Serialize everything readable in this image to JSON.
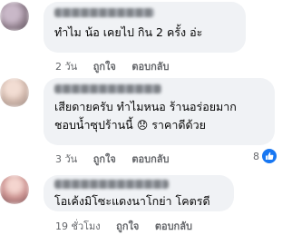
{
  "comments": [
    {
      "text_lines": [
        "ทำไม น้อ เคยไป กิน 2 ครั้ง อ่ะ"
      ],
      "time": "2 วัน",
      "like_label": "ถูกใจ",
      "reply_label": "ตอบกลับ",
      "reaction_count": ""
    },
    {
      "text_lines": [
        "เสียดายครับ ทำไมหนอ ร้านอร่อยมาก",
        "ชอบน้ำซุปร้านนี้"
      ],
      "text_suffix": "ราคาดีด้วย",
      "emoji": "😞",
      "time": "3 วัน",
      "like_label": "ถูกใจ",
      "reply_label": "ตอบกลับ",
      "reaction_count": "8"
    },
    {
      "text_lines": [
        "โอเค้งมิโซะแดงนาโกย่า โคตรดี"
      ],
      "time": "19 ชั่วโมง",
      "like_label": "ถูกใจ",
      "reply_label": "ตอบกลับ",
      "reaction_count": ""
    }
  ],
  "colors": {
    "bubble": "#f0f2f5",
    "meta_text": "#65676b",
    "like_blue": "#1877f2"
  },
  "icons": {
    "like_badge": "thumbs-up-icon"
  }
}
